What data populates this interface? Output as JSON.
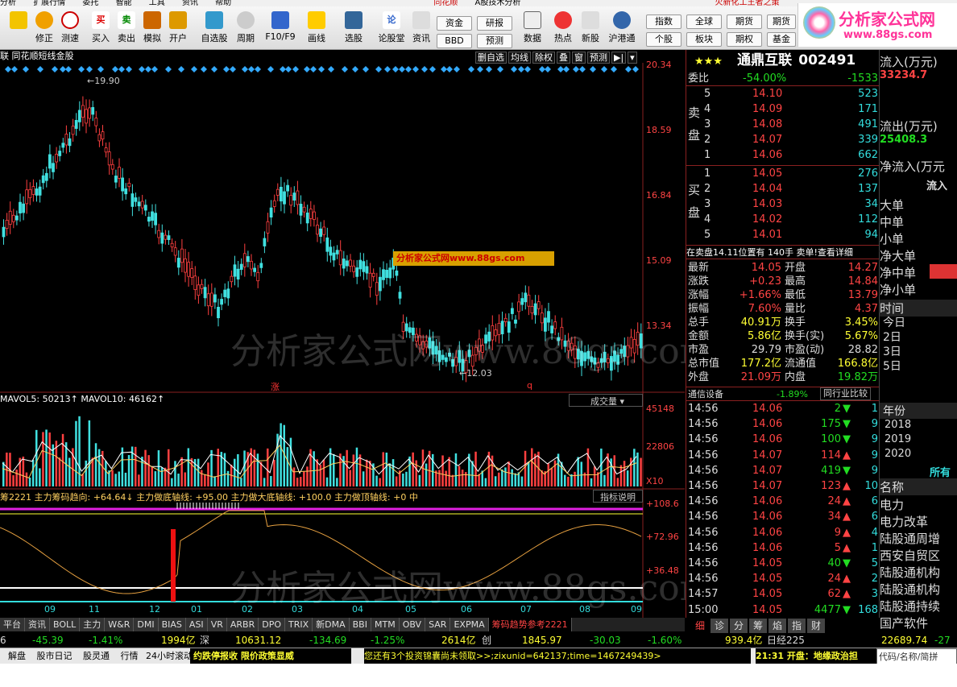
{
  "menubar": [
    "分析",
    "扩展行情",
    "委托",
    "智能",
    "工具",
    "资讯",
    "帮助",
    "同花顺",
    "A股技术分析",
    "火新化工王者之策"
  ],
  "toolbar": {
    "buttons": [
      "修正",
      "测速",
      "买入",
      "卖出",
      "模拟",
      "开户",
      "自选股",
      "周期",
      "F10/F9",
      "画线",
      "选股",
      "论股堂",
      "资讯",
      "数据",
      "热点",
      "新股",
      "沪港通"
    ],
    "mini": [
      "资金",
      "研报",
      "BBD",
      "预测",
      "指数",
      "全球",
      "个股",
      "板块",
      "期货",
      "期权",
      "基金"
    ],
    "logo_text": "分析家公式网",
    "logo_url": "www.88gs.com"
  },
  "chart": {
    "title": "联 同花顺短线金股",
    "buttons": [
      "删自选",
      "均线",
      "除权",
      "叠",
      "窗",
      "预测"
    ],
    "price_axis": [
      "20.34",
      "18.59",
      "16.84",
      "15.09",
      "13.34"
    ],
    "high_label": "19.90",
    "low_label": "12.03",
    "watermark": "分析家公式网www.88gs.com",
    "banner": "分析家公式网www.88gs.com",
    "vol_title": "MAVOL5: 50213↑ MAVOL10: 46162↑",
    "vol_dropdown": "成交量",
    "vol_axis": [
      "45148",
      "22806",
      "X10"
    ],
    "ind_title": "筹2221 主力筹码趋向: +64.64↓ 主力做底轴线: +95.00 主力做大底轴线: +100.0 主力做顶轴线: +0 中",
    "ind_button": "指标说明",
    "ind_axis": [
      "+108.6",
      "+72.96",
      "+36.48"
    ],
    "x_labels": [
      "09",
      "11",
      "12",
      "01",
      "02",
      "03",
      "04",
      "05",
      "06",
      "07",
      "08",
      "09"
    ],
    "markers": [
      "涨",
      "q"
    ]
  },
  "stock": {
    "stars": "★★★",
    "name": "通鼎互联",
    "code": "002491",
    "webi_label": "委比",
    "webi": "-54.00%",
    "webi_diff": "-1533",
    "asks": [
      [
        "5",
        "14.10",
        "523"
      ],
      [
        "4",
        "14.09",
        "171"
      ],
      [
        "3",
        "14.08",
        "491"
      ],
      [
        "2",
        "14.07",
        "339"
      ],
      [
        "1",
        "14.06",
        "662"
      ]
    ],
    "bids": [
      [
        "1",
        "14.05",
        "276"
      ],
      [
        "2",
        "14.04",
        "137"
      ],
      [
        "3",
        "14.03",
        "34"
      ],
      [
        "4",
        "14.02",
        "112"
      ],
      [
        "5",
        "14.01",
        "94"
      ]
    ],
    "sell_label": "卖盘",
    "buy_label": "买盘",
    "queue": "在卖盘14.11位置有 140手 卖单!查看详细",
    "stats": [
      [
        "最新",
        "14.05",
        "开盘",
        "14.27"
      ],
      [
        "涨跌",
        "+0.23",
        "最高",
        "14.84"
      ],
      [
        "涨幅",
        "+1.66%",
        "最低",
        "13.79"
      ],
      [
        "振幅",
        "7.60%",
        "量比",
        "4.37"
      ],
      [
        "总手",
        "40.91万",
        "换手",
        "3.45%"
      ],
      [
        "金额",
        "5.86亿",
        "换手(实)",
        "5.67%"
      ],
      [
        "市盈",
        "29.79",
        "市盈(动)",
        "28.82"
      ],
      [
        "总市值",
        "177.2亿",
        "流通值",
        "166.8亿"
      ],
      [
        "外盘",
        "21.09万",
        "内盘",
        "19.82万"
      ]
    ],
    "sector": "通信设备",
    "sector_change": "-1.89%",
    "compare": "同行业比较",
    "ticks": [
      [
        "14:56",
        "14.06",
        "2",
        "down",
        "1"
      ],
      [
        "14:56",
        "14.06",
        "175",
        "down",
        "9"
      ],
      [
        "14:56",
        "14.06",
        "100",
        "down",
        "9"
      ],
      [
        "14:56",
        "14.07",
        "114",
        "up",
        "9"
      ],
      [
        "14:56",
        "14.07",
        "419",
        "down",
        "9"
      ],
      [
        "14:56",
        "14.07",
        "123",
        "up",
        "10"
      ],
      [
        "14:56",
        "14.06",
        "24",
        "up",
        "6"
      ],
      [
        "14:56",
        "14.06",
        "34",
        "up",
        "6"
      ],
      [
        "14:56",
        "14.06",
        "9",
        "up",
        "4"
      ],
      [
        "14:56",
        "14.06",
        "5",
        "up",
        "1"
      ],
      [
        "14:56",
        "14.05",
        "40",
        "down",
        "5"
      ],
      [
        "14:56",
        "14.05",
        "24",
        "up",
        "2"
      ],
      [
        "14:57",
        "14.05",
        "62",
        "up",
        "3"
      ],
      [
        "15:00",
        "14.05",
        "4477",
        "down",
        "168"
      ]
    ],
    "bottom_tabs": [
      "细",
      "诊",
      "分",
      "筹",
      "焰",
      "指",
      "财"
    ]
  },
  "side": {
    "flow": [
      "流入(万元)",
      "33234.7",
      "流出(万元)",
      "25408.3",
      "净流入(万元",
      "流入"
    ],
    "orders": [
      "大单",
      "中单",
      "小单",
      "净大单",
      "净中单",
      "净小单"
    ],
    "time_title": "时间",
    "days": [
      "今日",
      "2日",
      "3日",
      "5日"
    ],
    "year_title": "年份",
    "years": [
      "2018",
      "2019",
      "2020"
    ],
    "sector_title": "所有",
    "sector_head": "名称",
    "sectors": [
      "电力",
      "电力改革",
      "陆股通周增",
      "西安自贸区",
      "陆股通机构",
      "陆股通机构",
      "陆股通持续",
      "国产软件"
    ]
  },
  "tabs": [
    "平台",
    "资讯",
    "BOLL",
    "主力",
    "W&R",
    "DMI",
    "BIAS",
    "ASI",
    "VR",
    "ARBR",
    "DPO",
    "TRIX",
    "新DMA",
    "BBI",
    "MTM",
    "OBV",
    "SAR",
    "EXPMA",
    "筹码趋势参考2221"
  ],
  "status": {
    "items": [
      "6",
      "-45.39",
      "-1.41%",
      "1994亿",
      "深",
      "10631.12",
      "-134.69",
      "-1.25%",
      "2614亿",
      "创",
      "1845.97",
      "-30.03",
      "-1.60%",
      "939.4亿",
      "日经225",
      "22689.74",
      "-27"
    ]
  },
  "bottombar": {
    "items": [
      "解盘",
      "股市日记",
      "股灵通",
      "行情",
      "24小时滚动"
    ],
    "news1": "约跌停报收 限价政策显威",
    "news2": "您还有3个投资锦囊尚未领取>>;zixunid=642137;time=1467249439>",
    "time": "21:31 开盘：地缘政治担",
    "search": "代码/名称/简拼"
  }
}
